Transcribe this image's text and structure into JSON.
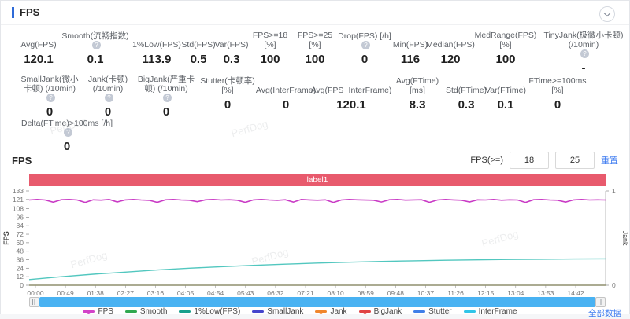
{
  "header": {
    "title": "FPS"
  },
  "watermark": {
    "text": "PerfDog"
  },
  "stats": {
    "rows": [
      {
        "items": [
          {
            "label": "Avg(FPS)",
            "value": "120.1"
          },
          {
            "label": "Smooth(流畅指数)",
            "help": true,
            "value": "0.1"
          },
          {
            "label": "1%Low(FPS)",
            "value": "113.9"
          },
          {
            "label": "Std(FPS)",
            "value": "0.5"
          },
          {
            "label": "Var(FPS)",
            "value": "0.3"
          },
          {
            "label": "FPS>=18 [%]",
            "value": "100"
          },
          {
            "label": "FPS>=25 [%]",
            "value": "100"
          },
          {
            "label": "Drop(FPS) [/h]",
            "help": true,
            "value": "0"
          },
          {
            "label": "Min(FPS)",
            "value": "116"
          },
          {
            "label": "Median(FPS)",
            "value": "120"
          },
          {
            "label": "MedRange(FPS)[%]",
            "value": "100"
          },
          {
            "label": "TinyJank(极微小卡顿) (/10min)",
            "help": true,
            "value": "-"
          }
        ]
      },
      {
        "items": [
          {
            "label": "SmallJank(微小卡顿) (/10min)",
            "help": true,
            "value": "0"
          },
          {
            "label": "Jank(卡顿) (/10min)",
            "help": true,
            "value": "0"
          },
          {
            "label": "BigJank(严重卡顿) (/10min)",
            "help": true,
            "value": "0"
          },
          {
            "label": "Stutter(卡顿率) [%]",
            "value": "0"
          },
          {
            "label": "Avg(InterFrame)",
            "value": "0"
          },
          {
            "label": "Avg(FPS+InterFrame)",
            "value": "120.1"
          },
          {
            "label": "Avg(FTime) [ms]",
            "value": "8.3"
          },
          {
            "label": "Std(FTime)",
            "value": "0.3"
          },
          {
            "label": "Var(FTime)",
            "value": "0.1"
          },
          {
            "label": "FTime>=100ms [%]",
            "value": "0"
          }
        ]
      },
      {
        "items": [
          {
            "label": "Delta(FTime)>100ms [/h]",
            "help": true,
            "value": "0"
          }
        ]
      }
    ]
  },
  "chart_section": {
    "title": "FPS",
    "threshold_label": "FPS(>=)",
    "threshold1": "18",
    "threshold2": "25",
    "reset_label": "重置",
    "banner_label": "label1",
    "all_data_label": "全部数据"
  },
  "chart_data": {
    "type": "line",
    "title": "label1",
    "x_ticks": [
      "00:00",
      "00:49",
      "01:38",
      "02:27",
      "03:16",
      "04:05",
      "04:54",
      "05:43",
      "06:32",
      "07:21",
      "08:10",
      "08:59",
      "09:48",
      "10:37",
      "11:26",
      "12:15",
      "13:04",
      "13:53",
      "14:42"
    ],
    "y_left": {
      "label": "FPS",
      "max": 133,
      "ticks": [
        0,
        12,
        24,
        36,
        48,
        60,
        72,
        84,
        96,
        108,
        121,
        133
      ]
    },
    "y_right": {
      "label": "Jank",
      "max": 1,
      "ticks": [
        0,
        1
      ]
    },
    "grid": false,
    "legend_position": "bottom",
    "series": [
      {
        "name": "FPS",
        "color": "#c93bc5",
        "values": [
          120.3,
          121,
          120.2,
          117.2,
          120.6,
          121,
          120.3,
          116.8,
          120.5,
          120,
          121,
          117.5,
          120.4,
          121,
          120.2,
          119.8,
          116.9,
          120.5,
          121,
          120.3,
          119.9,
          117.8,
          120.5,
          121,
          120.2,
          120.6,
          119.9,
          116.9,
          120.4,
          121,
          120.3,
          119.8,
          120.6,
          117.3,
          121,
          120.4,
          119.9,
          120.5,
          116.8,
          120.3,
          121,
          120.5,
          120.1,
          119.9,
          117.4,
          120.6,
          121,
          120,
          120.4,
          120.6,
          116.9,
          120.3,
          121,
          120.4,
          119.9,
          117.5,
          120.5,
          120.2,
          121,
          119.9,
          120.5,
          120.3,
          116.8,
          120.6,
          121,
          120.2,
          119.9,
          117.3,
          120.4,
          121,
          120.3,
          120.5,
          120.2
        ]
      },
      {
        "name": "InterFrame",
        "color": "#52c7bf",
        "values": [
          8,
          12,
          15.5,
          18.5,
          21.5,
          24,
          26.2,
          28,
          29.7,
          31.2,
          32.5,
          33.6,
          34.5,
          35.2,
          35.8,
          36.3,
          36.7,
          37,
          37.2
        ]
      },
      {
        "name": "zero-baseline",
        "color": "#8f8f6e",
        "values": [
          0,
          0,
          0,
          0,
          0,
          0,
          0,
          0,
          0,
          0,
          0,
          0,
          0,
          0,
          0,
          0,
          0,
          0,
          0
        ]
      }
    ],
    "legend": [
      {
        "name": "FPS",
        "color": "#d243c8",
        "dot": true
      },
      {
        "name": "Smooth",
        "color": "#2fa84f",
        "dot": false
      },
      {
        "name": "1%Low(FPS)",
        "color": "#16a08c",
        "dot": false
      },
      {
        "name": "SmallJank",
        "color": "#4545cc",
        "dot": false
      },
      {
        "name": "Jank",
        "color": "#f0862b",
        "dot": true
      },
      {
        "name": "BigJank",
        "color": "#e04343",
        "dot": true
      },
      {
        "name": "Stutter",
        "color": "#3f7fe8",
        "dot": false
      },
      {
        "name": "InterFrame",
        "color": "#30c5e8",
        "dot": false
      }
    ]
  }
}
